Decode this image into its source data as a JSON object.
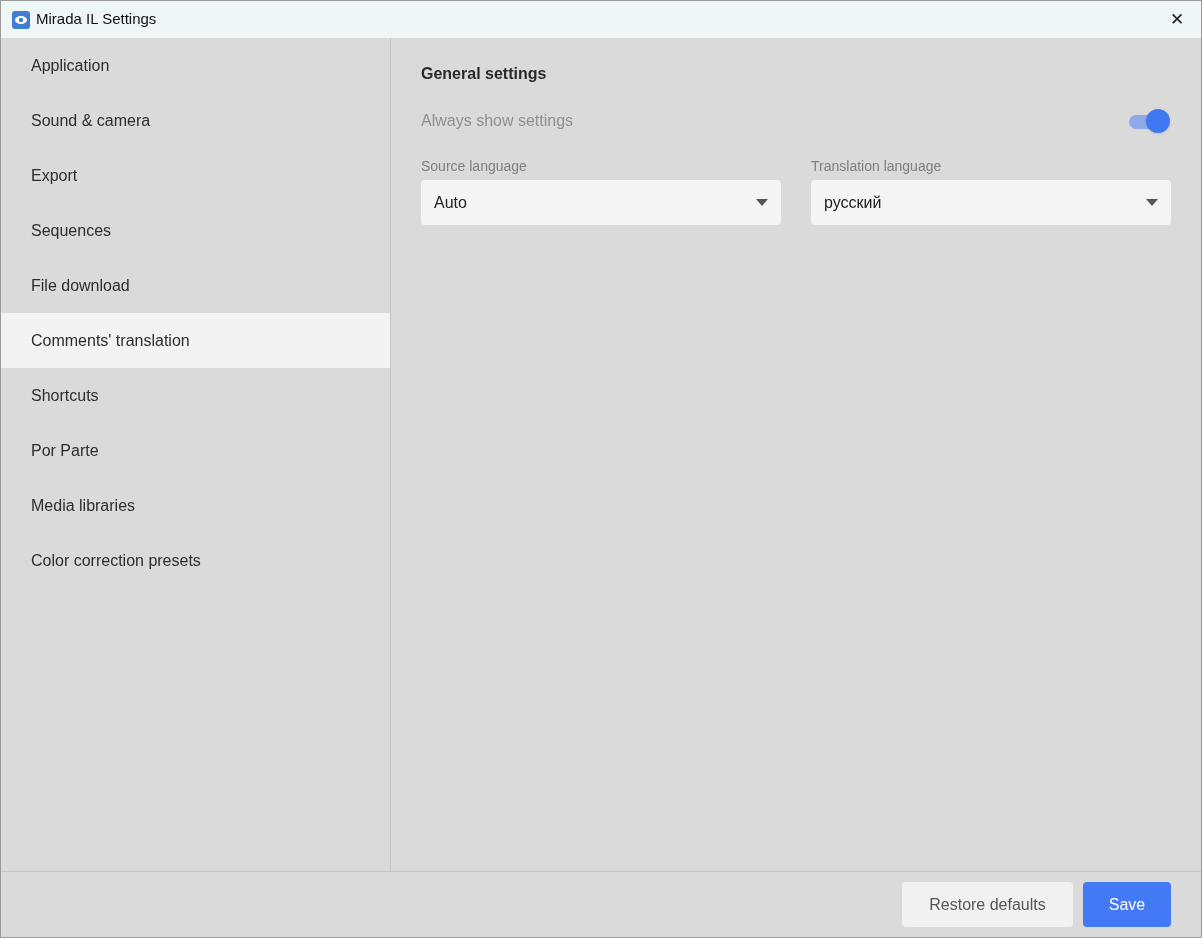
{
  "window": {
    "title": "Mirada IL Settings",
    "close": "✕"
  },
  "sidebar": {
    "items": [
      {
        "label": "Application",
        "selected": false
      },
      {
        "label": "Sound & camera",
        "selected": false
      },
      {
        "label": "Export",
        "selected": false
      },
      {
        "label": "Sequences",
        "selected": false
      },
      {
        "label": "File download",
        "selected": false
      },
      {
        "label": "Comments' translation",
        "selected": true
      },
      {
        "label": "Shortcuts",
        "selected": false
      },
      {
        "label": "Por Parte",
        "selected": false
      },
      {
        "label": "Media libraries",
        "selected": false
      },
      {
        "label": "Color correction presets",
        "selected": false
      }
    ]
  },
  "content": {
    "heading": "General settings",
    "toggle": {
      "label": "Always show settings",
      "on": true
    },
    "selects": [
      {
        "label": "Source language",
        "value": "Auto"
      },
      {
        "label": "Translation language",
        "value": "русский"
      }
    ]
  },
  "footer": {
    "buttons": [
      {
        "label": "Restore defaults",
        "kind": "secondary"
      },
      {
        "label": "Save",
        "kind": "primary"
      }
    ]
  }
}
